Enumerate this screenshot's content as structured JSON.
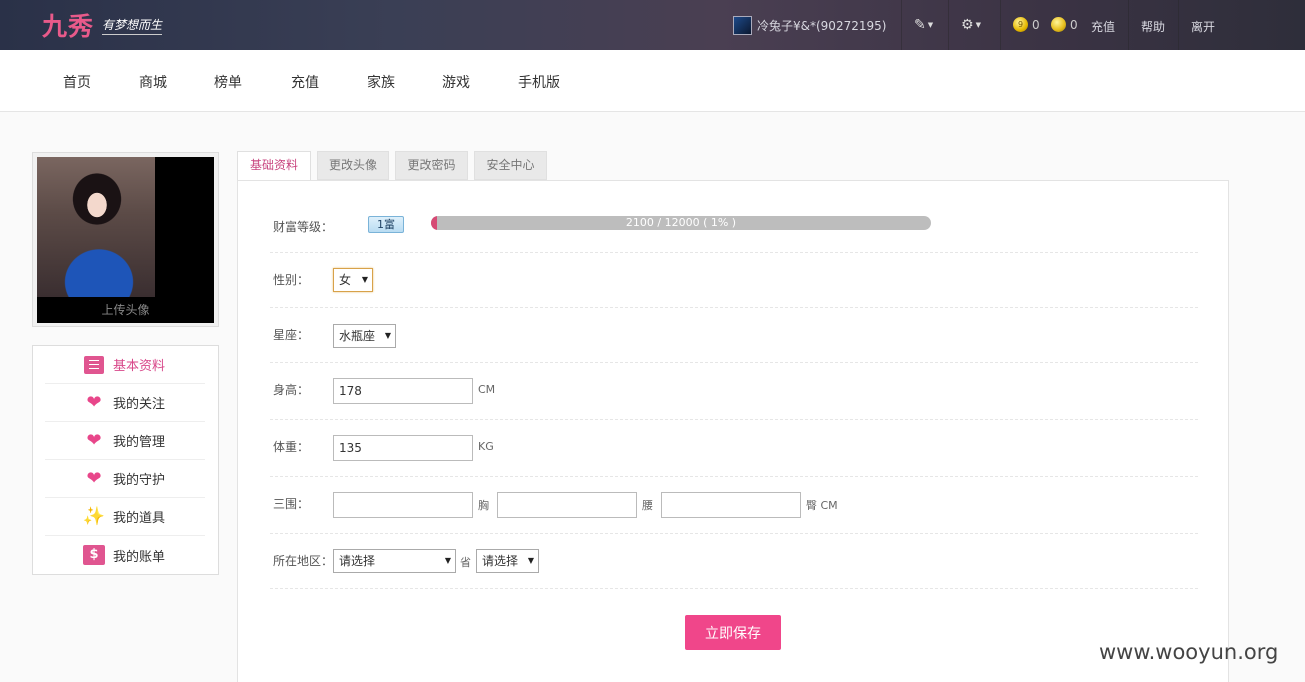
{
  "header": {
    "logo_main": "九秀",
    "logo_sub": "有梦想而生",
    "username": "冷兔子¥&*(90272195)",
    "coin_gold": "0",
    "coin_fruit": "0",
    "recharge_label": "充值",
    "help_label": "帮助",
    "leave_label": "离开"
  },
  "nav": {
    "items": [
      "首页",
      "商城",
      "榜单",
      "充值",
      "家族",
      "游戏",
      "手机版"
    ]
  },
  "sidebar": {
    "upload_label": "上传头像",
    "items": [
      {
        "label": "基本资料",
        "icon": "list-icon",
        "active": true
      },
      {
        "label": "我的关注",
        "icon": "heart-icon"
      },
      {
        "label": "我的管理",
        "icon": "heart-icon"
      },
      {
        "label": "我的守护",
        "icon": "heart-icon"
      },
      {
        "label": "我的道具",
        "icon": "magic-wand-icon"
      },
      {
        "label": "我的账单",
        "icon": "bill-icon"
      }
    ]
  },
  "tabs": [
    "基础资料",
    "更改头像",
    "更改密码",
    "安全中心"
  ],
  "form": {
    "wealth_label": "财富等级：",
    "wealth_badge": "1富",
    "wealth_progress_text": "2100 / 12000 ( 1% )",
    "wealth_progress_fraction": 0.01,
    "gender_label": "性别：",
    "gender_value": "女",
    "zodiac_label": "星座：",
    "zodiac_value": "水瓶座",
    "height_label": "身高：",
    "height_value": "178",
    "height_unit": "CM",
    "weight_label": "体重：",
    "weight_value": "135",
    "weight_unit": "KG",
    "measure_label": "三围：",
    "bust_unit": "胸",
    "waist_unit": "腰",
    "hip_unit": "臀 CM",
    "region_label": "所在地区：",
    "province_value": "请选择",
    "province_unit": "省",
    "city_value": "请选择",
    "save_label": "立即保存"
  },
  "colors": {
    "accent": "#f0468a",
    "active_text": "#d8488a"
  },
  "watermark": "www.wooyun.org"
}
